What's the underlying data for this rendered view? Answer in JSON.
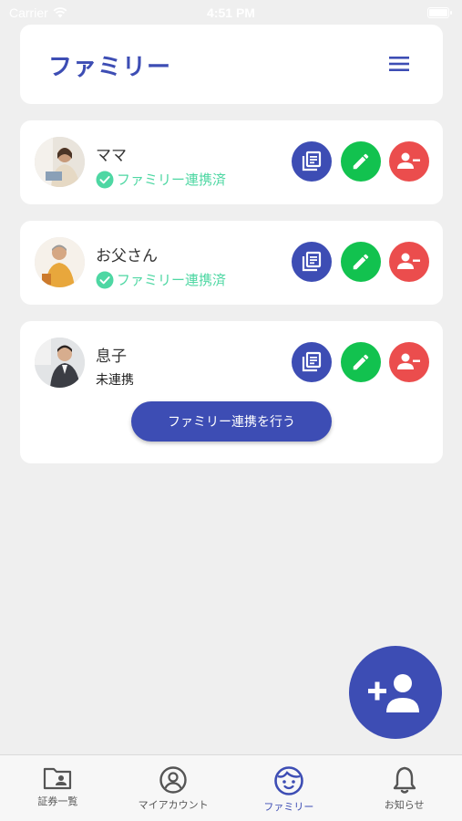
{
  "status_bar": {
    "carrier": "Carrier",
    "time": "4:51 PM"
  },
  "header": {
    "title": "ファミリー",
    "menu_icon": "hamburger-menu-icon"
  },
  "members": [
    {
      "name": "ママ",
      "status": "ファミリー連携済",
      "linked": true
    },
    {
      "name": "お父さん",
      "status": "ファミリー連携済",
      "linked": true
    },
    {
      "name": "息子",
      "status": "未連携",
      "linked": false,
      "action_label": "ファミリー連携を行う"
    }
  ],
  "member_actions": {
    "detail_icon": "document-list-icon",
    "edit_icon": "pencil-icon",
    "remove_icon": "remove-person-icon"
  },
  "fab": {
    "icon": "add-person-icon"
  },
  "tabs": [
    {
      "label": "証券一覧",
      "icon": "folder-person-icon",
      "active": false
    },
    {
      "label": "マイアカウント",
      "icon": "account-circle-icon",
      "active": false
    },
    {
      "label": "ファミリー",
      "icon": "child-face-icon",
      "active": true
    },
    {
      "label": "お知らせ",
      "icon": "bell-icon",
      "active": false
    }
  ],
  "colors": {
    "primary": "#3d4db4",
    "linked_green": "#4ed7a3",
    "edit_green": "#12c24f",
    "remove_red": "#eb4d4d",
    "background": "#efefef"
  }
}
